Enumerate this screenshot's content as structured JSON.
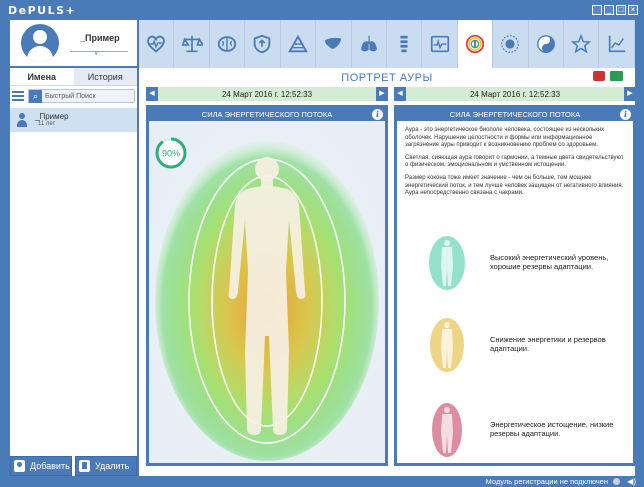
{
  "app": {
    "logo": "DePULS+"
  },
  "profile": {
    "name": "_Пример"
  },
  "left_tabs": [
    {
      "label": "Имена"
    },
    {
      "label": "История"
    }
  ],
  "search": {
    "placeholder": "Быстрый Поиск"
  },
  "user_list": [
    {
      "name": "_Пример",
      "age": "11 лет"
    }
  ],
  "bottom_buttons": {
    "add": "Добавить",
    "delete": "Удалить"
  },
  "top_icons": [
    "heart-icon",
    "scales-icon",
    "brain-icon",
    "shield-icon",
    "pyramid-icon",
    "liver-icon",
    "lungs-icon",
    "spine-icon",
    "cardiogram-icon",
    "aura-icon",
    "sun-icon",
    "yin-yang-icon",
    "star-icon",
    "chart-icon"
  ],
  "active_top_icon": "aura-icon",
  "page": {
    "title": "ПОРТРЕТ АУРЫ"
  },
  "left_panel": {
    "date": "24 Март 2016 г. 12:52:33",
    "header": "СИЛА ЭНЕРГЕТИЧЕСКОГО ПОТОКА",
    "percent_label": "90%",
    "percent": 90
  },
  "right_panel": {
    "date": "24 Март 2016 г. 12:52:33",
    "header": "СИЛА ЭНЕРГЕТИЧЕСКОГО ПОТОКА",
    "paragraphs": [
      "Аура - это энергетическое биополе человека, состоящее из нескольких оболочек. Нарушение целостности и формы или информационное загрязнение ауры приводит к возникновению проблем со здоровьем.",
      "Светлая, сияющая аура говорит о гармонии, а темные цвета свидетельствуют о физическом, эмоциональном и умственном истощении.",
      "Размер кокона тоже имеет значение - чем он больше, тем мощнее энергетический поток, и тем лучше человек защищен от негативного влияния. Аура непосредственно связана с чакрами."
    ],
    "legend": [
      {
        "text": "Высокий энергетический уровень, хорошие резервы адаптации.",
        "color": "#3cc8a0"
      },
      {
        "text": "Снижение энергетики и резервов адаптации.",
        "color": "#e0b020"
      },
      {
        "text": "Энергетическое истощение, низкие резервы адаптации.",
        "color": "#c03050"
      }
    ]
  },
  "status": {
    "text": "Модуль регистрации не подключен"
  }
}
